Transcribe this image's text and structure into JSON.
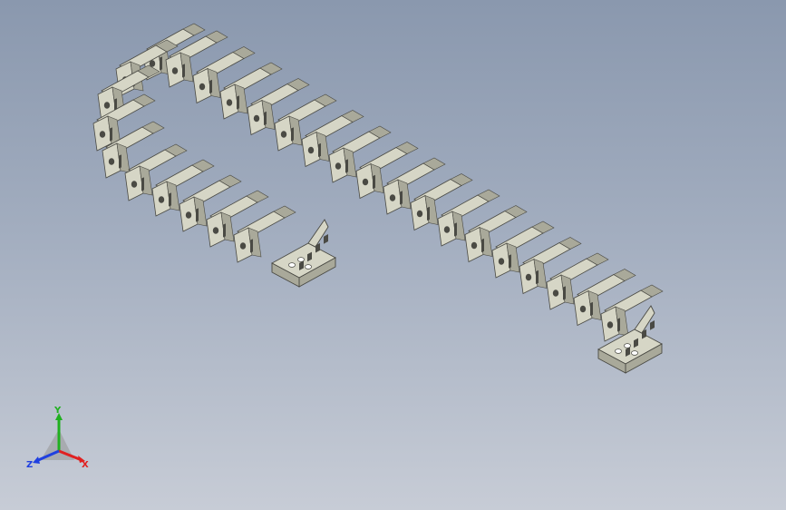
{
  "viewport": {
    "background_top": "#8a98ae",
    "background_bottom": "#c7ccd6"
  },
  "model": {
    "part_color": "#d6d6c6",
    "shade_color": "#a9a99a",
    "dark_color": "#4a4a44"
  },
  "triad": {
    "x_label": "X",
    "y_label": "Y",
    "z_label": "Z",
    "x_color": "#e02020",
    "y_color": "#20b020",
    "z_color": "#2040e0"
  }
}
